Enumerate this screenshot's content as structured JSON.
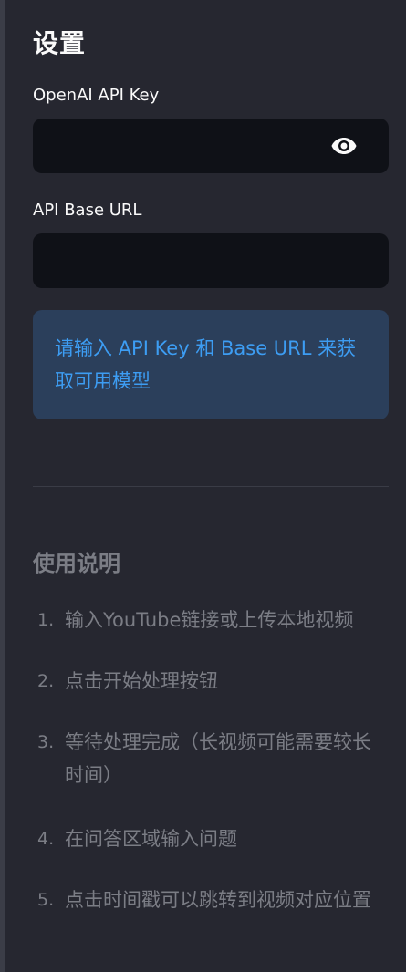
{
  "sidebar": {
    "title": "设置",
    "api_key": {
      "label": "OpenAI API Key",
      "value": "",
      "placeholder": "",
      "toggle_icon": "eye-icon"
    },
    "base_url": {
      "label": "API Base URL",
      "value": "",
      "placeholder": ""
    },
    "info_message": "请输入 API Key 和 Base URL 来获取可用模型",
    "instructions": {
      "title": "使用说明",
      "steps": [
        {
          "num": "1.",
          "text": "输入YouTube链接或上传本地视频"
        },
        {
          "num": "2.",
          "text": "点击开始处理按钮"
        },
        {
          "num": "3.",
          "text": "等待处理完成（长视频可能需要较长时间）"
        },
        {
          "num": "4.",
          "text": "在问答区域输入问题"
        },
        {
          "num": "5.",
          "text": "点击时间戳可以跳转到视频对应位置"
        }
      ]
    }
  },
  "colors": {
    "sidebar_bg": "#262730",
    "input_bg": "#0f1117",
    "info_bg": "#2b3f5b",
    "info_text": "#3d9df3",
    "muted_text": "#7b7d85",
    "primary_text": "#fafafa"
  }
}
